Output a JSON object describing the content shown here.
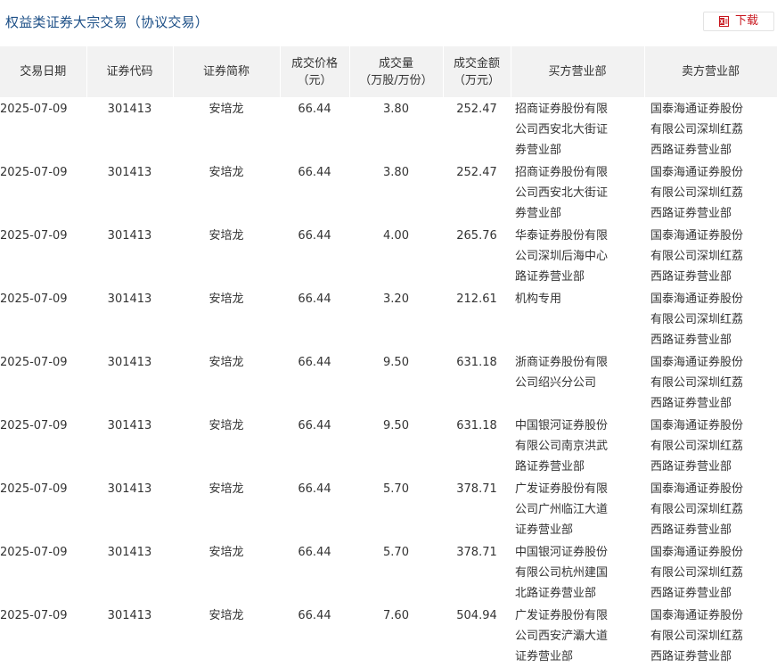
{
  "page": {
    "title": "权益类证券大宗交易（协议交易）",
    "download_label": "下载",
    "download_icon": "excel-file-icon",
    "accent_color": "#c8161e",
    "title_color": "#1b4e86",
    "header_bg": "#f2f2f2"
  },
  "table": {
    "headers": {
      "date": "交易日期",
      "code": "证券代码",
      "name": "证券简称",
      "price_l1": "成交价格",
      "price_l2": "（元）",
      "volume_l1": "成交量",
      "volume_l2": "（万股/万份）",
      "amount_l1": "成交金额",
      "amount_l2": "（万元）",
      "buyer": "买方营业部",
      "seller": "卖方营业部"
    },
    "rows": [
      {
        "date": "2025-07-09",
        "code": "301413",
        "name": "安培龙",
        "price": "66.44",
        "volume": "3.80",
        "amount": "252.47",
        "buyer": "招商证券股份有限公司西安北大街证券营业部",
        "seller": "国泰海通证券股份有限公司深圳红荔西路证券营业部"
      },
      {
        "date": "2025-07-09",
        "code": "301413",
        "name": "安培龙",
        "price": "66.44",
        "volume": "3.80",
        "amount": "252.47",
        "buyer": "招商证券股份有限公司西安北大街证券营业部",
        "seller": "国泰海通证券股份有限公司深圳红荔西路证券营业部"
      },
      {
        "date": "2025-07-09",
        "code": "301413",
        "name": "安培龙",
        "price": "66.44",
        "volume": "4.00",
        "amount": "265.76",
        "buyer": "华泰证券股份有限公司深圳后海中心路证券营业部",
        "seller": "国泰海通证券股份有限公司深圳红荔西路证券营业部"
      },
      {
        "date": "2025-07-09",
        "code": "301413",
        "name": "安培龙",
        "price": "66.44",
        "volume": "3.20",
        "amount": "212.61",
        "buyer": "机构专用",
        "seller": "国泰海通证券股份有限公司深圳红荔西路证券营业部"
      },
      {
        "date": "2025-07-09",
        "code": "301413",
        "name": "安培龙",
        "price": "66.44",
        "volume": "9.50",
        "amount": "631.18",
        "buyer": "浙商证券股份有限公司绍兴分公司",
        "seller": "国泰海通证券股份有限公司深圳红荔西路证券营业部"
      },
      {
        "date": "2025-07-09",
        "code": "301413",
        "name": "安培龙",
        "price": "66.44",
        "volume": "9.50",
        "amount": "631.18",
        "buyer": "中国银河证券股份有限公司南京洪武路证券营业部",
        "seller": "国泰海通证券股份有限公司深圳红荔西路证券营业部"
      },
      {
        "date": "2025-07-09",
        "code": "301413",
        "name": "安培龙",
        "price": "66.44",
        "volume": "5.70",
        "amount": "378.71",
        "buyer": "广发证券股份有限公司广州临江大道证券营业部",
        "seller": "国泰海通证券股份有限公司深圳红荔西路证券营业部"
      },
      {
        "date": "2025-07-09",
        "code": "301413",
        "name": "安培龙",
        "price": "66.44",
        "volume": "5.70",
        "amount": "378.71",
        "buyer": "中国银河证券股份有限公司杭州建国北路证券营业部",
        "seller": "国泰海通证券股份有限公司深圳红荔西路证券营业部"
      },
      {
        "date": "2025-07-09",
        "code": "301413",
        "name": "安培龙",
        "price": "66.44",
        "volume": "7.60",
        "amount": "504.94",
        "buyer": "广发证券股份有限公司西安浐灞大道证券营业部",
        "seller": "国泰海通证券股份有限公司深圳红荔西路证券营业部"
      }
    ]
  }
}
